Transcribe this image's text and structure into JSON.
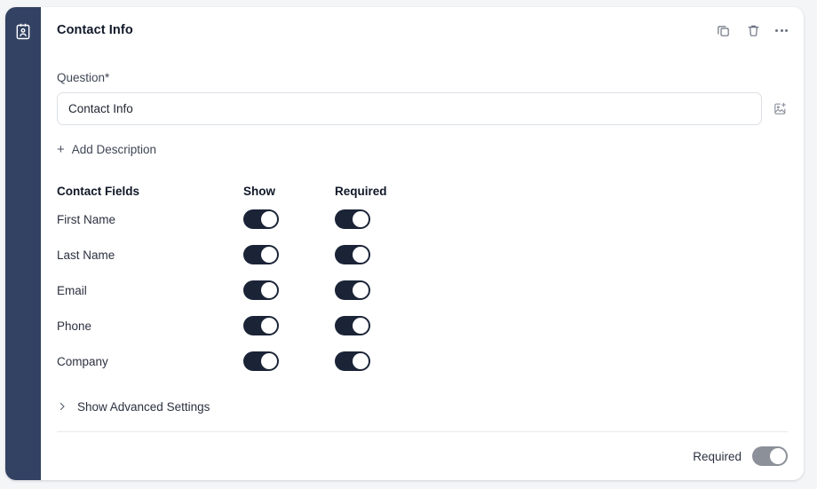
{
  "sidebar": {
    "icon": "contact-card-icon"
  },
  "header": {
    "title": "Contact Info",
    "actions": [
      {
        "name": "duplicate-icon",
        "label": "Duplicate"
      },
      {
        "name": "trash-icon",
        "label": "Delete"
      },
      {
        "name": "more-options-icon",
        "label": "More options"
      }
    ]
  },
  "question": {
    "label": "Question*",
    "value": "Contact Info",
    "placeholder": "Contact Info",
    "image_button": "add-image-icon"
  },
  "add_description": {
    "label": "Add Description",
    "icon": "plus-icon"
  },
  "contact_fields": {
    "headers": {
      "name": "Contact Fields",
      "show": "Show",
      "required": "Required"
    },
    "rows": [
      {
        "label": "First Name",
        "show": true,
        "required": true
      },
      {
        "label": "Last Name",
        "show": true,
        "required": true
      },
      {
        "label": "Email",
        "show": true,
        "required": true
      },
      {
        "label": "Phone",
        "show": true,
        "required": true
      },
      {
        "label": "Company",
        "show": true,
        "required": true
      }
    ]
  },
  "advanced_settings": {
    "label": "Show Advanced Settings",
    "icon": "chevron-right-icon",
    "expanded": false
  },
  "footer": {
    "required_label": "Required",
    "required_on": true
  },
  "colors": {
    "rail": "#334263",
    "toggle_on": "#1b2437",
    "toggle_gray": "#8b9099",
    "page_bg": "#f4f5f7",
    "card_bg": "#ffffff",
    "border": "#dcdfe4",
    "text": "#101828",
    "muted": "#6b7280"
  }
}
